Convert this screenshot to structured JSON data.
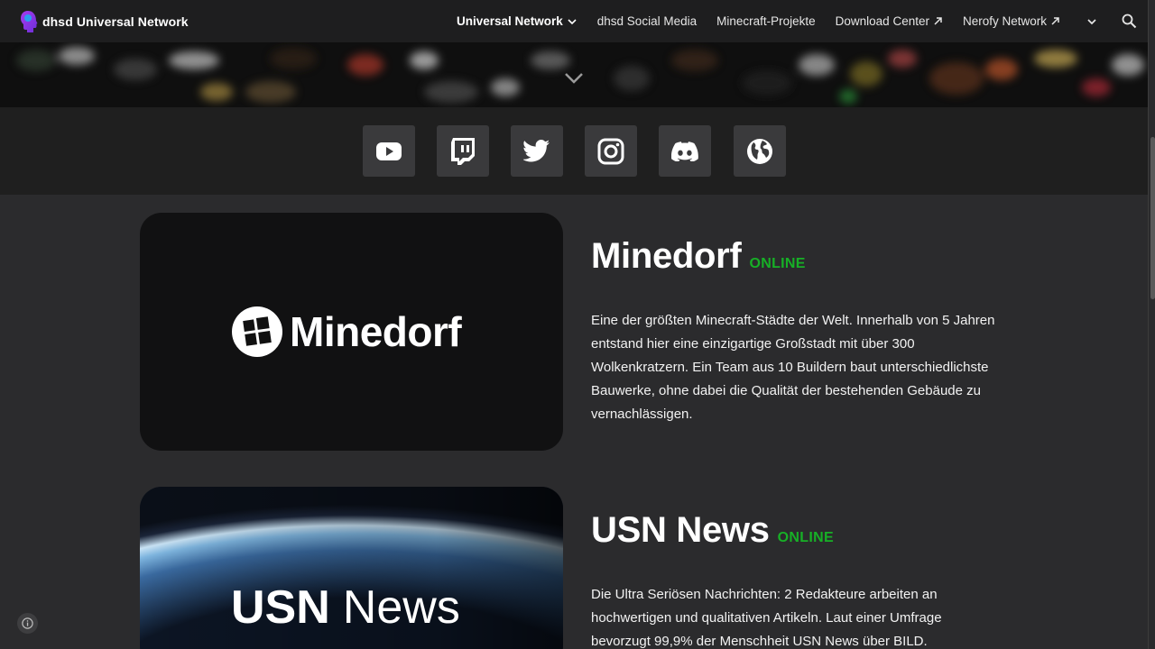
{
  "brand": {
    "title": "dhsd Universal Network",
    "logo_icon": "head-silhouette-logo"
  },
  "nav": {
    "items": [
      {
        "label": "Universal Network",
        "active": true,
        "icon": "chevron-down-icon"
      },
      {
        "label": "dhsd Social Media"
      },
      {
        "label": "Minecraft-Projekte"
      },
      {
        "label": "Download Center",
        "icon": "external-link-icon"
      },
      {
        "label": "Nerofy Network",
        "icon": "external-link-icon"
      }
    ],
    "more_icon": "chevron-down-icon",
    "search_icon": "search-icon"
  },
  "hero": {
    "scroll_icon": "chevron-down-icon"
  },
  "social": {
    "buttons": [
      "youtube-icon",
      "twitch-icon",
      "twitter-icon",
      "instagram-icon",
      "discord-icon",
      "globe-icon"
    ]
  },
  "projects": [
    {
      "name": "Minedorf",
      "status": "ONLINE",
      "logo_text": "Minedorf",
      "description": "Eine der größten Minecraft-Städte der Welt. Innerhalb von 5 Jahren entstand hier eine einzigartige Großstadt mit über 300 Wolkenkratzern. Ein Team aus 10 Buildern baut unterschiedlichste Bauwerke, ohne dabei die Qualität der bestehenden Gebäude zu vernachlässigen."
    },
    {
      "name": "USN News",
      "status": "ONLINE",
      "logo_text_bold": "USN",
      "logo_text_light": "News",
      "description": "Die Ultra Seriösen Nachrichten: 2 Redakteure arbeiten an hochwertigen und qualitativen Artikeln. Laut einer Umfrage bevorzugt 99,9% der Menschheit USN News über BILD."
    }
  ],
  "colors": {
    "accent_status": "#17b026",
    "topbar": "#1e1e1f",
    "page_bg": "#2b2b2d"
  }
}
